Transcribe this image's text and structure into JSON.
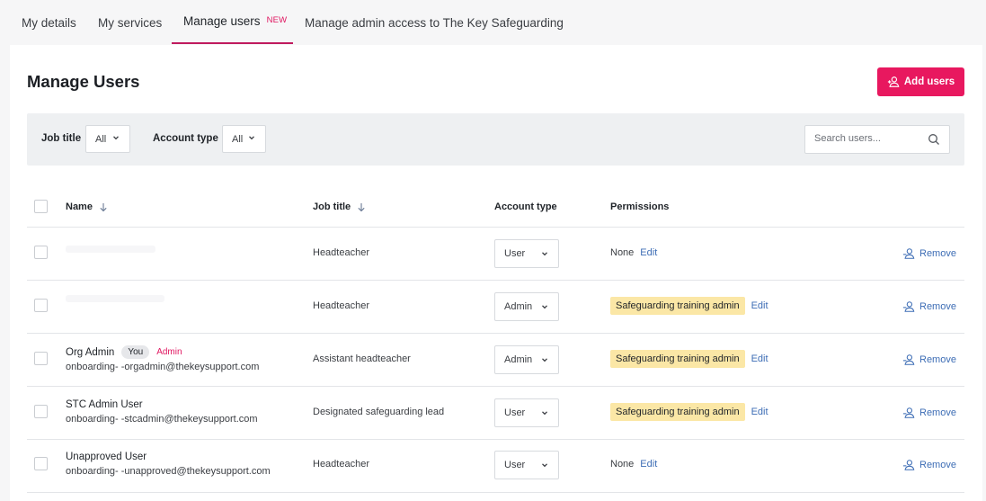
{
  "tabs": [
    {
      "label": "My details"
    },
    {
      "label": "My services"
    },
    {
      "label": "Manage users",
      "badge": "NEW"
    },
    {
      "label": "Manage admin access to The Key Safeguarding"
    }
  ],
  "page": {
    "title": "Manage Users",
    "add_button": "Add users"
  },
  "filters": {
    "job_title_label": "Job title",
    "job_title_value": "All",
    "account_type_label": "Account type",
    "account_type_value": "All",
    "search_placeholder": "Search users..."
  },
  "table": {
    "headers": {
      "name": "Name",
      "job_title": "Job title",
      "account_type": "Account type",
      "permissions": "Permissions"
    },
    "rows": [
      {
        "name": "",
        "email": "",
        "job": "Headteacher",
        "account": "User",
        "perm_text": "None",
        "perm_badge": "",
        "edit": "Edit",
        "remove": "Remove"
      },
      {
        "name": "",
        "email": "",
        "job": "Headteacher",
        "account": "Admin",
        "perm_text": "",
        "perm_badge": "Safeguarding training admin",
        "edit": "Edit",
        "remove": "Remove"
      },
      {
        "name": "Org Admin",
        "you": "You",
        "admin": "Admin",
        "email": "onboarding-   -orgadmin@thekeysupport.com",
        "job": "Assistant headteacher",
        "account": "Admin",
        "perm_text": "",
        "perm_badge": "Safeguarding training admin",
        "edit": "Edit",
        "remove": "Remove"
      },
      {
        "name": "STC Admin User",
        "email": "onboarding-   -stcadmin@thekeysupport.com",
        "job": "Designated safeguarding lead",
        "account": "User",
        "perm_text": "",
        "perm_badge": "Safeguarding training admin",
        "edit": "Edit",
        "remove": "Remove"
      },
      {
        "name": "Unapproved User",
        "email": "onboarding-   -unapproved@thekeysupport.com",
        "job": "Headteacher",
        "account": "User",
        "perm_text": "None",
        "perm_badge": "",
        "edit": "Edit",
        "remove": "Remove"
      }
    ]
  },
  "colors": {
    "accent": "#e8185f",
    "tab_underline": "#c01a5e",
    "link": "#3d6db5",
    "badge_bg": "#fbe7a6"
  },
  "icons": {
    "add_user": "add-user-icon",
    "search": "search-icon",
    "sort": "arrow-down-icon",
    "chevron": "chevron-down-icon",
    "remove": "user-remove-icon"
  }
}
